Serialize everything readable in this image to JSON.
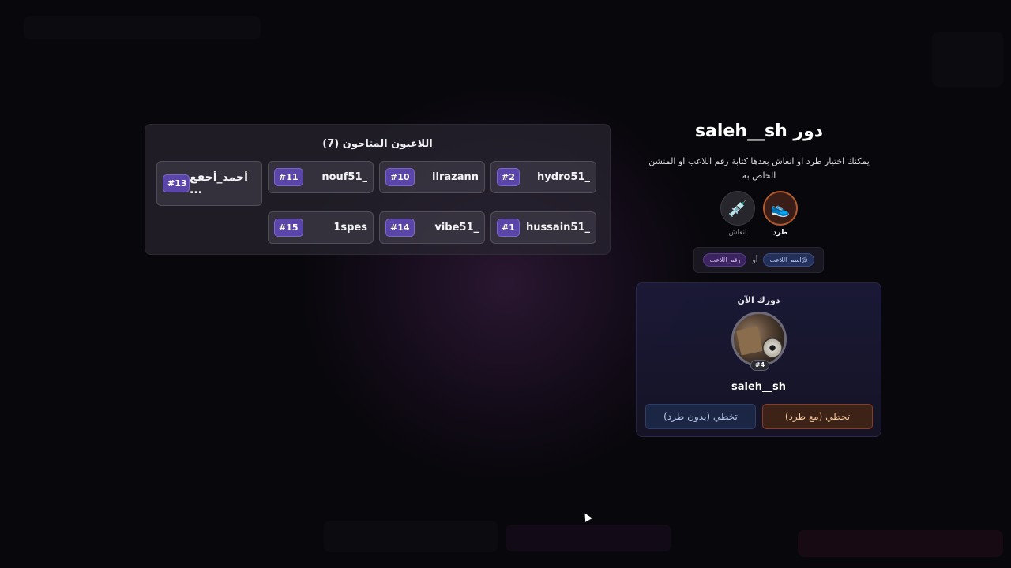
{
  "players_panel": {
    "title": "اللاعبون المتاحون (7)",
    "players": [
      {
        "number": "#2",
        "name": "hydro51_"
      },
      {
        "number": "#10",
        "name": "ilrazann"
      },
      {
        "number": "#11",
        "name": "nouf51_"
      },
      {
        "number": "#13",
        "name": "أحمد_أحقع ..."
      },
      {
        "number": "#1",
        "name": "hussain51_"
      },
      {
        "number": "#14",
        "name": "vibe51_"
      },
      {
        "number": "#15",
        "name": "1spes"
      }
    ]
  },
  "turn": {
    "title": "دور saleh__sh",
    "hint": "يمكنك اختيار طرد او انعاش بعدها كتابة رقم اللاعب او المنشن الخاص به"
  },
  "actions": {
    "kick": {
      "label": "طرد",
      "icon": "sneaker-icon"
    },
    "revive": {
      "label": "انعاش",
      "icon": "syringe-icon"
    }
  },
  "mention": {
    "name_pill": "@اسم_اللاعب",
    "or": "أو",
    "number_pill": "رقم_اللاعب"
  },
  "current_turn": {
    "label": "دورك الآن",
    "badge": "#4",
    "name": "saleh__sh",
    "skip_with_kick": "تخطي (مع طرد)",
    "skip_without_kick": "تخطي (بدون طرد)"
  },
  "colors": {
    "accent_purple": "#5a46a8",
    "kick_orange": "#b25a2e",
    "background": "#08070b"
  }
}
